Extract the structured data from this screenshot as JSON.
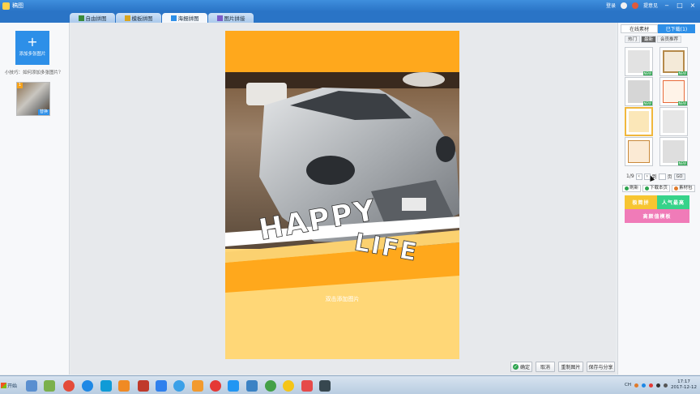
{
  "window": {
    "title": "稿图",
    "login_label": "登录",
    "feedback_label": "提意见",
    "minimize_icon": "minimize-icon",
    "maximize_icon": "maximize-icon",
    "close_icon": "close-icon"
  },
  "tabs": [
    {
      "label": "自由拼图",
      "active": false
    },
    {
      "label": "模板拼图",
      "active": false
    },
    {
      "label": "海报拼图",
      "active": true
    },
    {
      "label": "图片拼接",
      "active": false
    }
  ],
  "left_panel": {
    "add_button_label": "添加多张图片",
    "tip": "小技巧：如何添加多张图片？",
    "thumbnail": {
      "index": "1",
      "replace_label": "替换"
    }
  },
  "poster": {
    "headline_1": "HAPPY",
    "headline_2": "LIFE",
    "add_image_hint": "双击添加图片",
    "colors": {
      "top_band": "#ffa81c",
      "bottom": "#ffd777",
      "stripe": "#ffa81c"
    }
  },
  "bottom_actions": {
    "confirm": "确定",
    "cancel": "取消",
    "reset": "重制图片",
    "save_share": "保存与分享"
  },
  "right_panel": {
    "tab_online": "在线素材",
    "tab_downloaded": "已下载(1)",
    "subtabs": [
      {
        "label": "热门",
        "active": false
      },
      {
        "label": "最新",
        "active": true
      },
      {
        "label": "会员推荐",
        "active": false
      }
    ],
    "pager": {
      "page": "1/9",
      "goto_label": "到",
      "page_suffix": "页",
      "go_label": "GO"
    },
    "actions": {
      "refresh": "刷新",
      "download_page": "下载本页",
      "library": "素材包"
    },
    "categories": [
      {
        "label": "极简拼",
        "color": "#f7c531"
      },
      {
        "label": "人气最高",
        "color": "#37d38a"
      },
      {
        "label": "高颜值模板",
        "color": "#f07bb8"
      }
    ]
  },
  "taskbar": {
    "start_label": "开始",
    "lang_indicator": "CH",
    "clock_time": "17:17",
    "clock_date": "2017-12-12"
  }
}
